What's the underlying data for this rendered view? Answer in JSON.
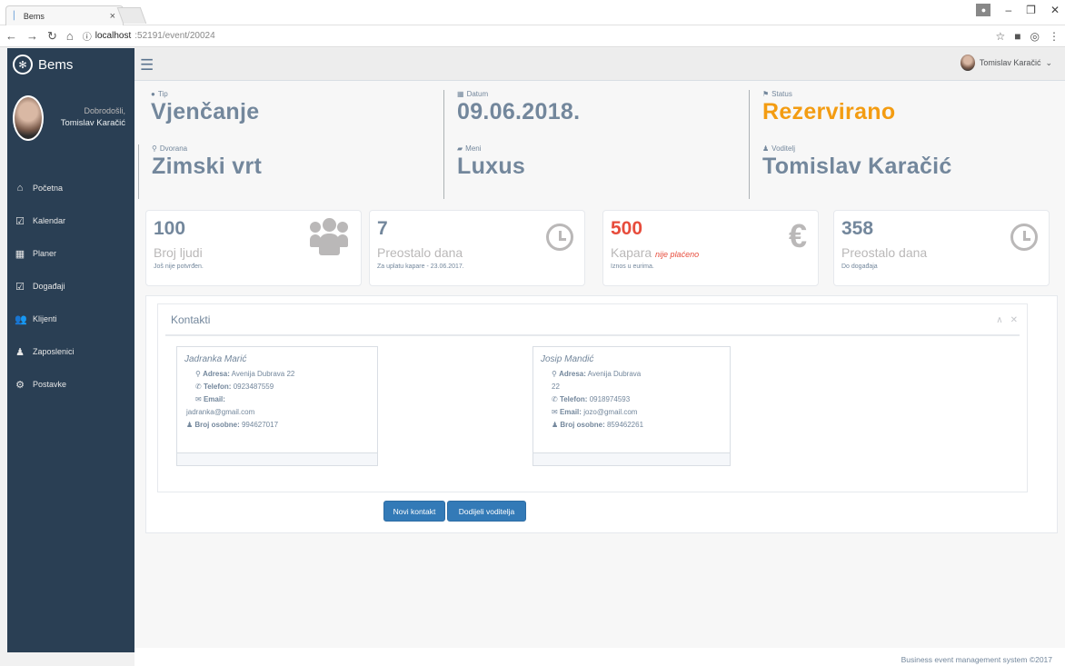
{
  "browser": {
    "tab_title": "Bems",
    "tab_close": "×",
    "url_host": "localhost",
    "url_path": ":52191/event/20024"
  },
  "app": {
    "name": "Bems",
    "welcome": "Dobrodošli,",
    "user_name": "Tomislav Karačić",
    "top_user": "Tomislav Karačić"
  },
  "menu": [
    {
      "label": "Početna",
      "icon": "home-icon"
    },
    {
      "label": "Kalendar",
      "icon": "calendar-check-icon"
    },
    {
      "label": "Planer",
      "icon": "calendar-icon"
    },
    {
      "label": "Događaji",
      "icon": "calendar-check-icon"
    },
    {
      "label": "Klijenti",
      "icon": "users-icon"
    },
    {
      "label": "Zaposlenici",
      "icon": "user-icon"
    },
    {
      "label": "Postavke",
      "icon": "cogs-icon"
    }
  ],
  "info": {
    "tip_label": "Tip",
    "tip_value": "Vjenčanje",
    "datum_label": "Datum",
    "datum_value": "09.06.2018.",
    "status_label": "Status",
    "status_value": "Rezervirano",
    "dvorana_label": "Dvorana",
    "dvorana_value": "Zimski vrt",
    "meni_label": "Meni",
    "meni_value": "Luxus",
    "voditelj_label": "Voditelj",
    "voditelj_value": "Tomislav Karačić"
  },
  "stats": [
    {
      "number": "100",
      "title": "Broj ljudi",
      "sub": "Još nije potvrđen."
    },
    {
      "number": "7",
      "title": "Preostalo dana",
      "sub": "Za uplatu kapare - 23.06.2017."
    },
    {
      "number": "500",
      "title": "Kapara",
      "note": "nije plaćeno",
      "sub": "Iznos u eurima."
    },
    {
      "number": "358",
      "title": "Preostalo dana",
      "sub": "Do događaja"
    }
  ],
  "contacts_panel": {
    "title": "Kontakti",
    "contacts": [
      {
        "name": "Jadranka Marić",
        "address_label": "Adresa:",
        "address": "Avenija Dubrava 22",
        "phone_label": "Telefon:",
        "phone": "0923487559",
        "email_label": "Email:",
        "email": "jadranka@gmail.com",
        "id_label": "Broj osobne:",
        "id": "994627017"
      },
      {
        "name": "Josip Mandić",
        "address_label": "Adresa:",
        "address": "Avenija Dubrava 22",
        "phone_label": "Telefon:",
        "phone": "0918974593",
        "email_label": "Email:",
        "email": "jozo@gmail.com",
        "id_label": "Broj osobne:",
        "id": "859462261"
      }
    ]
  },
  "buttons": {
    "new_contact": "Novi kontakt",
    "assign_manager": "Dodijeli voditelja"
  },
  "footer": "Business event management system ©2017",
  "colors": {
    "sidebar": "#2a3f54",
    "status": "#f39c12",
    "danger": "#e74c3c",
    "primary": "#337ab7"
  }
}
